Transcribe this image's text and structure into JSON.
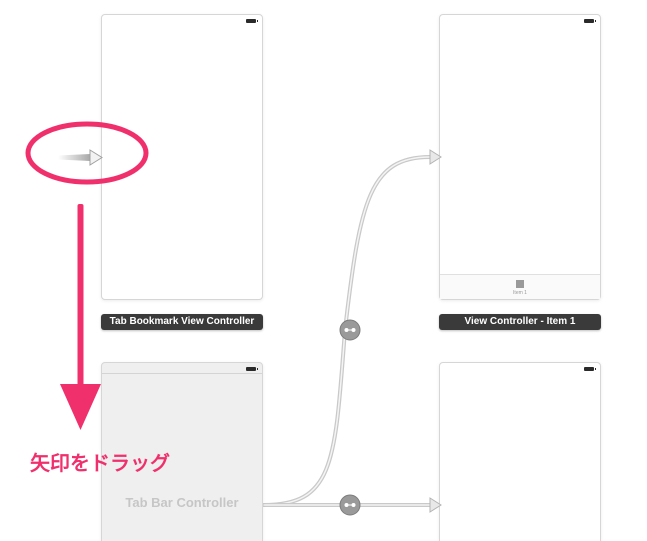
{
  "scenes": {
    "tab_bookmark_vc": {
      "title": "Tab Bookmark View Controller"
    },
    "view_controller_item1": {
      "title": "View Controller - Item 1",
      "tab_item_label": "Item 1"
    },
    "tab_bar_controller": {
      "label": "Tab Bar Controller"
    }
  },
  "annotation": {
    "text": "矢印をドラッグ"
  },
  "colors": {
    "accent": "#f0306d",
    "title_bar": "#3a3a3a",
    "segue_line": "#b8b8b8",
    "frame_border": "#d6d6d6"
  },
  "icons": [
    "entry-point-arrow-icon",
    "segue-relationship-icon",
    "down-arrow-icon"
  ]
}
